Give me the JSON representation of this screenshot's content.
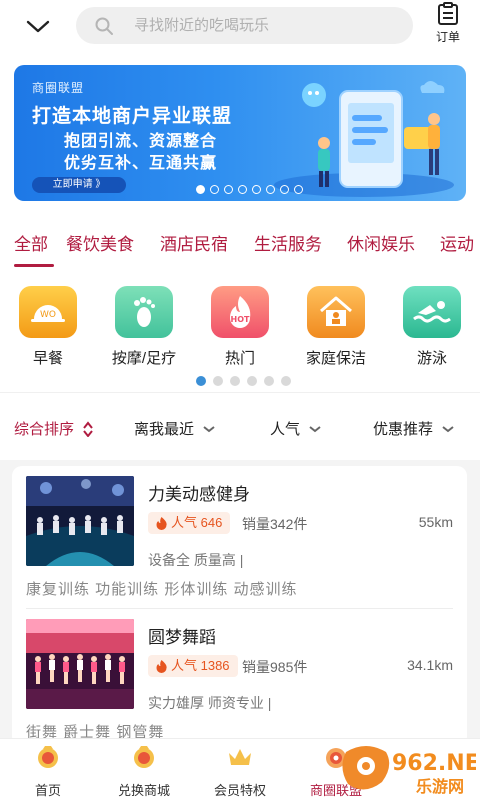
{
  "header": {
    "search_placeholder": "寻找附近的吃喝玩乐",
    "orders_label": "订单"
  },
  "banner": {
    "tag": "商圈联盟",
    "headline": "打造本地商户异业联盟",
    "line2": "抱团引流、资源整合",
    "line3": "优劣互补、互通共赢",
    "apply": "立即申请 》",
    "dots": 8,
    "active_dot": 0
  },
  "tabs": [
    "全部",
    "餐饮美食",
    "酒店民宿",
    "生活服务",
    "休闲娱乐",
    "运动"
  ],
  "categories": [
    {
      "label": "早餐",
      "icon": "breakfast-icon",
      "color": "#f6a21c"
    },
    {
      "label": "按摩/足疗",
      "icon": "footprint-icon",
      "color": "#5fcfa8"
    },
    {
      "label": "热门",
      "icon": "hot-flame-icon",
      "color": "#f26b6b"
    },
    {
      "label": "家庭保洁",
      "icon": "house-cleaning-icon",
      "color": "#f39a2c"
    },
    {
      "label": "游泳",
      "icon": "swimming-icon",
      "color": "#3ec9a0"
    }
  ],
  "category_pages": 6,
  "sort": {
    "options": [
      "综合排序",
      "离我最近",
      "人气",
      "优惠推荐"
    ]
  },
  "shops": [
    {
      "name": "力美动感健身",
      "popularity": "人气 646",
      "sales": "销量342件",
      "distance": "55km",
      "desc": "设备全 质量高 |",
      "tags": "康复训练 功能训练 形体训练 动感训练"
    },
    {
      "name": "圆梦舞蹈",
      "popularity": "人气 1386",
      "sales": "销量985件",
      "distance": "34.1km",
      "desc": "实力雄厚 师资专业 |",
      "tags": "街舞 爵士舞 钢管舞"
    }
  ],
  "bottom_nav": [
    {
      "label": "首页",
      "icon": "home-icon"
    },
    {
      "label": "兑换商城",
      "icon": "exchange-mall-icon"
    },
    {
      "label": "会员特权",
      "icon": "crown-icon"
    },
    {
      "label": "商圈联盟",
      "icon": "alliance-icon",
      "active": true
    }
  ],
  "watermark": {
    "text": "962.NET",
    "sub": "乐游网"
  },
  "colors": {
    "accent": "#b01c40",
    "popularity": "#e6541f",
    "banner": "#2f8ff0"
  }
}
